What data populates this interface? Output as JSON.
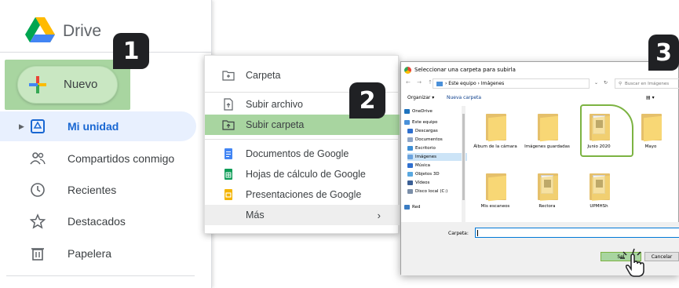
{
  "drive": {
    "app_name": "Drive",
    "new_button": "Nuevo",
    "nav": [
      {
        "label": "Mi unidad",
        "icon": "my-drive-icon",
        "active": true
      },
      {
        "label": "Compartidos conmigo",
        "icon": "shared-people-icon"
      },
      {
        "label": "Recientes",
        "icon": "clock-icon"
      },
      {
        "label": "Destacados",
        "icon": "star-icon"
      },
      {
        "label": "Papelera",
        "icon": "trash-icon"
      }
    ]
  },
  "badges": [
    "1",
    "2",
    "3"
  ],
  "menu": {
    "items": [
      {
        "label": "Carpeta",
        "icon": "new-folder-icon"
      },
      {
        "label": "Subir archivo",
        "icon": "upload-file-icon"
      },
      {
        "label": "Subir carpeta",
        "icon": "upload-folder-icon",
        "selected": true
      },
      {
        "label": "Documentos de Google",
        "icon": "google-docs-icon"
      },
      {
        "label": "Hojas de cálculo de Google",
        "icon": "google-sheets-icon"
      },
      {
        "label": "Presentaciones de Google",
        "icon": "google-slides-icon"
      },
      {
        "label": "Más",
        "icon": "chevron-right-icon"
      }
    ]
  },
  "dialog": {
    "title": "Seleccionar una carpeta para subirla",
    "breadcrumb": "› Este equipo › Imágenes",
    "search_placeholder": "Buscar en Imágenes",
    "organize": "Organizar ▾",
    "new_folder": "Nueva carpeta",
    "tree": [
      {
        "label": "OneDrive",
        "color": "#1e73be"
      },
      {
        "label": "Este equipo",
        "color": "#4a90d9"
      },
      {
        "label": "Descargas",
        "color": "#2f6fcf"
      },
      {
        "label": "Documentos",
        "color": "#8fa6c8"
      },
      {
        "label": "Escritorio",
        "color": "#3d8fd6"
      },
      {
        "label": "Imágenes",
        "color": "#6aa3de",
        "selected": true
      },
      {
        "label": "Música",
        "color": "#2f6fcf"
      },
      {
        "label": "Objetos 3D",
        "color": "#59a8e0"
      },
      {
        "label": "Vídeos",
        "color": "#3b5f95"
      },
      {
        "label": "Disco local (C:)",
        "color": "#7a8ea8"
      },
      {
        "label": "Red",
        "color": "#3b7cc2"
      }
    ],
    "files": [
      {
        "label": "Álbum de la cámara"
      },
      {
        "label": "Imágenes guardadas"
      },
      {
        "label": "Junio 2020"
      },
      {
        "label": "Mayo"
      },
      {
        "label": "Mis escaneos"
      },
      {
        "label": "Rectora"
      },
      {
        "label": "UPMHSh"
      }
    ],
    "folder_label": "Carpeta:",
    "select_button": "Sel",
    "cancel_button": "Cancelar"
  }
}
